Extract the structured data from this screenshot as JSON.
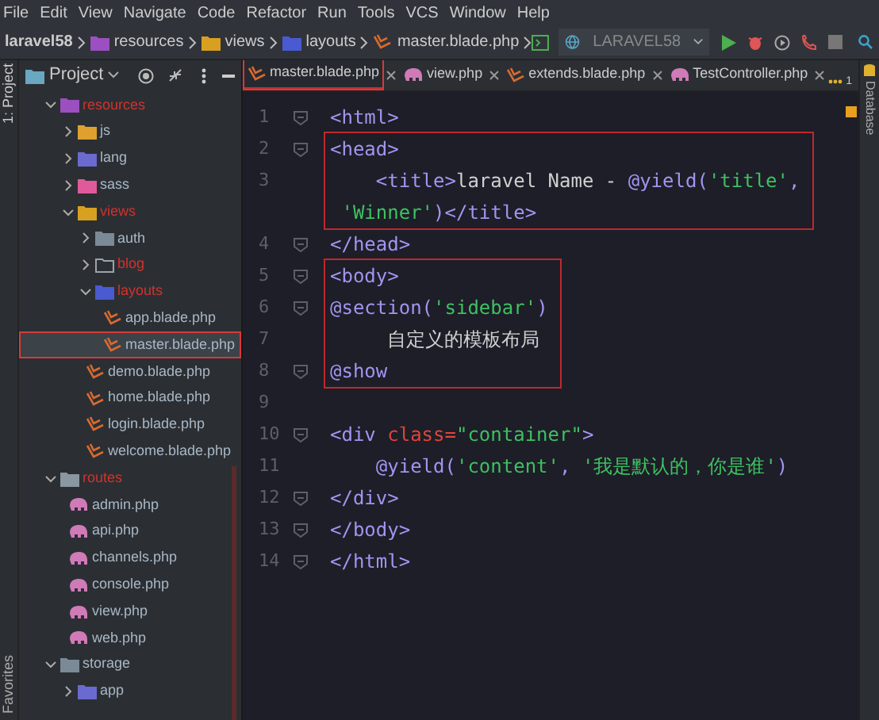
{
  "menu": [
    "File",
    "Edit",
    "View",
    "Navigate",
    "Code",
    "Refactor",
    "Run",
    "Tools",
    "VCS",
    "Window",
    "Help"
  ],
  "breadcrumbs": [
    {
      "label": "laravel58",
      "kind": "project"
    },
    {
      "label": "resources",
      "kind": "resources"
    },
    {
      "label": "views",
      "kind": "views"
    },
    {
      "label": "layouts",
      "kind": "layouts"
    },
    {
      "label": "master.blade.php",
      "kind": "blade"
    }
  ],
  "run_config": "LARAVEL58",
  "tool_strip": {
    "left_top": "1: Project",
    "left_bottom": "Favorites",
    "right": "Database"
  },
  "project_panel": {
    "title": "Project",
    "tree": [
      {
        "label": "resources",
        "kind": "resources",
        "color": "#d2322d",
        "expanded": true,
        "selected": false,
        "children": [
          {
            "label": "js",
            "kind": "js",
            "color": "#a9b7c6",
            "expanded": false,
            "selected": false
          },
          {
            "label": "lang",
            "kind": "lang",
            "color": "#a9b7c6",
            "expanded": false,
            "selected": false
          },
          {
            "label": "sass",
            "kind": "sass",
            "color": "#a9b7c6",
            "expanded": false,
            "selected": false
          },
          {
            "label": "views",
            "kind": "views",
            "color": "#d2322d",
            "expanded": true,
            "selected": false,
            "children": [
              {
                "label": "auth",
                "kind": "folder",
                "color": "#a9b7c6",
                "expanded": false,
                "selected": false
              },
              {
                "label": "blog",
                "kind": "outline-folder",
                "color": "#d2322d",
                "expanded": false,
                "selected": false
              },
              {
                "label": "layouts",
                "kind": "layouts",
                "color": "#d2322d",
                "expanded": true,
                "selected": false,
                "children": [
                  {
                    "label": "app.blade.php",
                    "kind": "blade",
                    "color": "#a9b7c6",
                    "selected": false
                  },
                  {
                    "label": "master.blade.php",
                    "kind": "blade",
                    "color": "#a9b7c6",
                    "selected": true
                  }
                ]
              },
              {
                "label": "demo.blade.php",
                "kind": "blade",
                "color": "#a9b7c6",
                "selected": false
              },
              {
                "label": "home.blade.php",
                "kind": "blade",
                "color": "#a9b7c6",
                "selected": false
              },
              {
                "label": "login.blade.php",
                "kind": "blade",
                "color": "#a9b7c6",
                "selected": false
              },
              {
                "label": "welcome.blade.php",
                "kind": "blade",
                "color": "#a9b7c6",
                "selected": false
              }
            ]
          }
        ]
      },
      {
        "label": "routes",
        "kind": "routes",
        "color": "#d2322d",
        "expanded": true,
        "selected": false,
        "children": [
          {
            "label": "admin.php",
            "kind": "php",
            "color": "#a9b7c6",
            "selected": false
          },
          {
            "label": "api.php",
            "kind": "php",
            "color": "#a9b7c6",
            "selected": false
          },
          {
            "label": "channels.php",
            "kind": "php",
            "color": "#a9b7c6",
            "selected": false
          },
          {
            "label": "console.php",
            "kind": "php",
            "color": "#a9b7c6",
            "selected": false
          },
          {
            "label": "view.php",
            "kind": "php",
            "color": "#a9b7c6",
            "selected": false
          },
          {
            "label": "web.php",
            "kind": "php",
            "color": "#a9b7c6",
            "selected": false
          }
        ]
      },
      {
        "label": "storage",
        "kind": "folder",
        "color": "#a9b7c6",
        "expanded": true,
        "selected": false,
        "children": [
          {
            "label": "app",
            "kind": "lang",
            "color": "#a9b7c6",
            "expanded": false,
            "selected": false
          }
        ]
      }
    ]
  },
  "tabs": [
    {
      "label": "master.blade.php",
      "kind": "blade",
      "selected": true
    },
    {
      "label": "view.php",
      "kind": "php",
      "selected": false
    },
    {
      "label": "extends.blade.php",
      "kind": "blade",
      "selected": false
    },
    {
      "label": "TestController.php",
      "kind": "php",
      "selected": false
    }
  ],
  "tab_overflow": "1",
  "editor": {
    "blocks": [
      {
        "boxed": false,
        "lines": [
          {
            "number": "1",
            "fold": true,
            "rows": [
              [
                {
                  "kind": "tag",
                  "text": "<html>"
                }
              ]
            ]
          }
        ]
      },
      {
        "boxed": true,
        "lines": [
          {
            "number": "2",
            "fold": true,
            "rows": [
              [
                {
                  "kind": "tag",
                  "text": "<head>"
                }
              ]
            ]
          },
          {
            "number": "3",
            "fold": false,
            "rows": [
              [
                {
                  "kind": "plain",
                  "text": "    "
                },
                {
                  "kind": "tag",
                  "text": "<title>"
                },
                {
                  "kind": "plain",
                  "text": "laravel Name - "
                },
                {
                  "kind": "tag",
                  "text": "@yield("
                },
                {
                  "kind": "string",
                  "text": "'title'"
                },
                {
                  "kind": "tag",
                  "text": ","
                }
              ],
              [
                {
                  "kind": "plain",
                  "text": " "
                },
                {
                  "kind": "string",
                  "text": "'Winner'"
                },
                {
                  "kind": "tag",
                  "text": ")</title>"
                }
              ]
            ]
          }
        ]
      },
      {
        "boxed": false,
        "lines": [
          {
            "number": "4",
            "fold": true,
            "rows": [
              [
                {
                  "kind": "tag",
                  "text": "</head>"
                }
              ]
            ]
          }
        ]
      },
      {
        "boxed": true,
        "lines": [
          {
            "number": "5",
            "fold": true,
            "rows": [
              [
                {
                  "kind": "tag",
                  "text": "<body>"
                }
              ]
            ]
          },
          {
            "number": "6",
            "fold": true,
            "rows": [
              [
                {
                  "kind": "tag",
                  "text": "@section("
                },
                {
                  "kind": "string",
                  "text": "'sidebar'"
                },
                {
                  "kind": "tag",
                  "text": ")"
                }
              ]
            ]
          },
          {
            "number": "7",
            "fold": false,
            "rows": [
              [
                {
                  "kind": "plain",
                  "text": "     自定义的模板布局"
                }
              ]
            ]
          },
          {
            "number": "8",
            "fold": true,
            "rows": [
              [
                {
                  "kind": "tag",
                  "text": "@show"
                }
              ]
            ]
          }
        ]
      },
      {
        "boxed": false,
        "lines": [
          {
            "number": "9",
            "fold": false,
            "rows": [
              []
            ]
          },
          {
            "number": "10",
            "fold": true,
            "rows": [
              [
                {
                  "kind": "tag",
                  "text": "<div "
                },
                {
                  "kind": "attr",
                  "text": "class="
                },
                {
                  "kind": "string",
                  "text": "\"container\""
                },
                {
                  "kind": "tag",
                  "text": ">"
                }
              ]
            ]
          },
          {
            "number": "11",
            "fold": false,
            "rows": [
              [
                {
                  "kind": "plain",
                  "text": "    "
                },
                {
                  "kind": "tag",
                  "text": "@yield("
                },
                {
                  "kind": "string",
                  "text": "'content'"
                },
                {
                  "kind": "tag",
                  "text": ", "
                },
                {
                  "kind": "string",
                  "text": "'我是默认的，你是谁'"
                },
                {
                  "kind": "tag",
                  "text": ")"
                }
              ]
            ]
          },
          {
            "number": "12",
            "fold": true,
            "rows": [
              [
                {
                  "kind": "tag",
                  "text": "</div>"
                }
              ]
            ]
          },
          {
            "number": "13",
            "fold": true,
            "rows": [
              [
                {
                  "kind": "tag",
                  "text": "</body>"
                }
              ]
            ]
          },
          {
            "number": "14",
            "fold": true,
            "rows": [
              [
                {
                  "kind": "tag",
                  "text": "</html>"
                }
              ]
            ]
          }
        ]
      }
    ]
  }
}
